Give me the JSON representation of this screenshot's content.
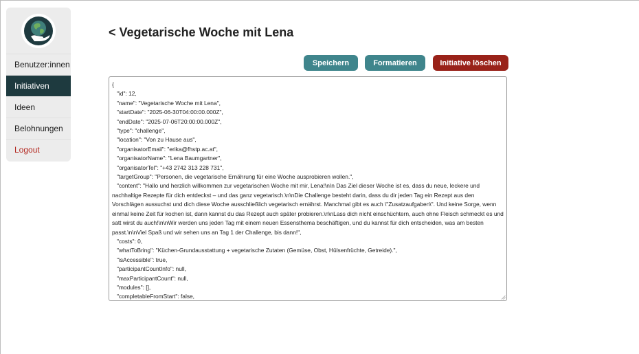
{
  "sidebar": {
    "logo_icon": "globe-hand-icon",
    "items": [
      {
        "label": "Benutzer:innen",
        "active": false
      },
      {
        "label": "Initiativen",
        "active": true
      },
      {
        "label": "Ideen",
        "active": false
      },
      {
        "label": "Belohnungen",
        "active": false
      },
      {
        "label": "Logout",
        "active": false
      }
    ]
  },
  "header": {
    "title": "< Vegetarische Woche mit Lena"
  },
  "toolbar": {
    "save_label": "Speichern",
    "format_label": "Formatieren",
    "delete_label": "Initiative löschen"
  },
  "colors": {
    "sidebar_bg": "#ececec",
    "active_nav": "#1e3a3f",
    "primary_button": "#3f858c",
    "danger_button": "#992219",
    "logout_text": "#b3271f"
  },
  "editor": {
    "content": "{\n   \"id\": 12,\n   \"name\": \"Vegetarische Woche mit Lena\",\n   \"startDate\": \"2025-06-30T04:00:00.000Z\",\n   \"endDate\": \"2025-07-06T20:00:00.000Z\",\n   \"type\": \"challenge\",\n   \"location\": \"Von zu Hause aus\",\n   \"organisatorEmail\": \"erika@fhstp.ac.at\",\n   \"organisatorName\": \"Lena Baumgartner\",\n   \"organisatorTel\": \"+43 2742 313 228 731\",\n   \"targetGroup\": \"Personen, die vegetarische Ernährung für eine Woche ausprobieren wollen.\",\n   \"content\": \"Hallo und herzlich willkommen zur vegetarischen Woche mit mir, Lena!\\n\\n Das Ziel dieser Woche ist es, dass du neue, leckere und nachhaltige Rezepte für dich entdeckst – und das ganz vegetarisch.\\n\\nDie Challenge besteht darin, dass du dir jeden Tag ein Rezept aus den Vorschlägen aussuchst und dich diese Woche ausschließlich vegetarisch ernährst. Manchmal gibt es auch \\\"Zusatzaufgaben\\\". Und keine Sorge, wenn einmal keine Zeit für kochen ist, dann kannst du das Rezept auch später probieren.\\n\\nLass dich nicht einschüchtern, auch ohne Fleisch schmeckt es und satt wirst du auch!\\n\\nWir werden uns jeden Tag mit einem neuen Essensthema beschäftigen, und du kannst für dich entscheiden, was am besten passt.\\n\\nViel Spaß und wir sehen uns an Tag 1 der Challenge, bis dann!\",\n   \"costs\": 0,\n   \"whatToBring\": \"Küchen-Grundausstattung + vegetarische Zutaten (Gemüse, Obst, Hülsenfrüchte, Getreide).\",\n   \"isAccessible\": true,\n   \"participantCountInfo\": null,\n   \"maxParticipantCount\": null,\n   \"modules\": [],\n   \"completableFromStart\": false,"
  }
}
